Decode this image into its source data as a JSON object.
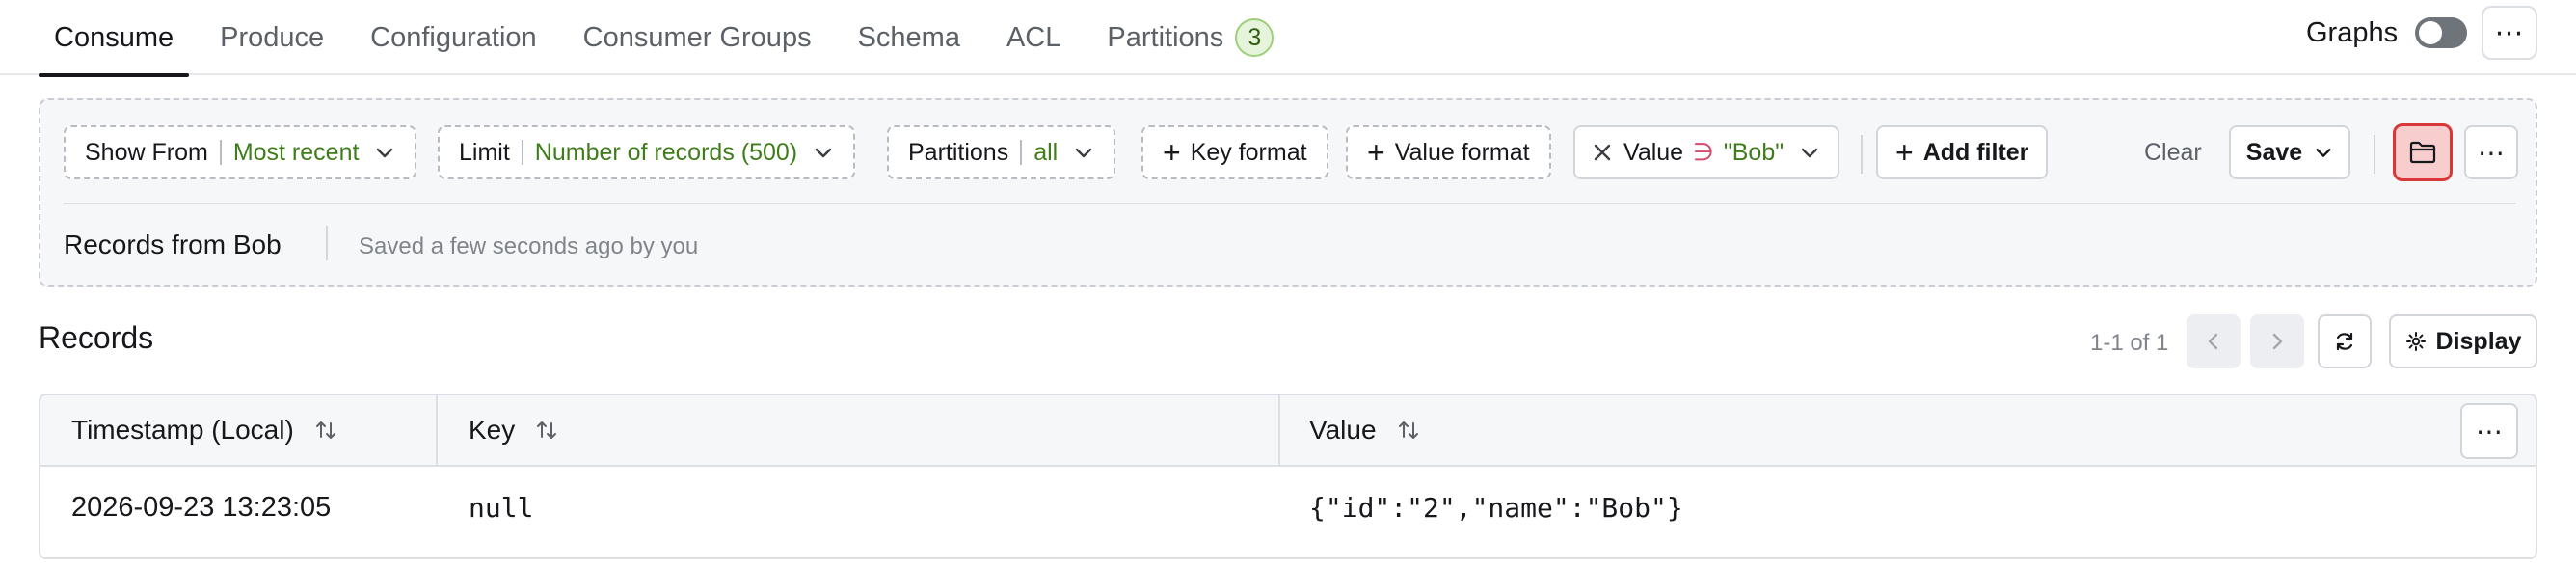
{
  "tabs": [
    {
      "label": "Consume",
      "active": true
    },
    {
      "label": "Produce"
    },
    {
      "label": "Configuration"
    },
    {
      "label": "Consumer Groups"
    },
    {
      "label": "Schema"
    },
    {
      "label": "ACL"
    },
    {
      "label": "Partitions",
      "count": "3"
    }
  ],
  "header": {
    "graphs_label": "Graphs",
    "graphs_enabled": false
  },
  "filters": {
    "show_from": {
      "label": "Show From",
      "value": "Most recent"
    },
    "limit": {
      "label": "Limit",
      "value": "Number of records (500)"
    },
    "partitions": {
      "label": "Partitions",
      "value": "all"
    },
    "key_format": "Key format",
    "value_format": "Value format",
    "value_filter": {
      "label": "Value",
      "operator": "∋",
      "value": "\"Bob\""
    },
    "add_filter": "Add filter",
    "clear": "Clear",
    "save": "Save"
  },
  "saved_filter": {
    "name": "Records from Bob",
    "meta": "Saved a few seconds ago by you"
  },
  "records": {
    "title": "Records",
    "pagination": "1-1 of 1",
    "display_label": "Display",
    "columns": [
      "Timestamp (Local)",
      "Key",
      "Value"
    ],
    "rows": [
      {
        "timestamp": "2026-09-23 13:23:05",
        "key": "null",
        "value": "{\"id\":\"2\",\"name\":\"Bob\"}"
      }
    ]
  },
  "colors": {
    "accent_value": "#3f7d1a",
    "active_folder_border": "#d93838",
    "active_folder_bg": "#f7cdcd",
    "badge_bg": "#e6f4dc"
  }
}
